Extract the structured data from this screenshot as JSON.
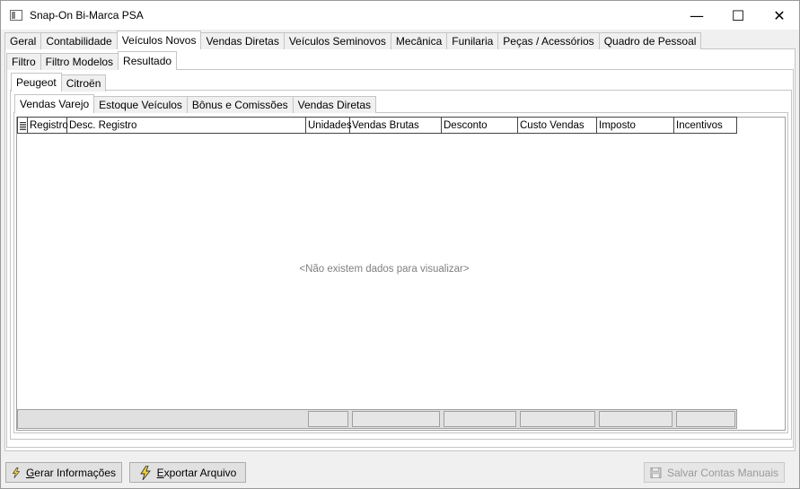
{
  "window": {
    "title": "Snap-On Bi-Marca PSA",
    "minimize_glyph": "—",
    "maximize_glyph": "☐",
    "close_glyph": "✕"
  },
  "main_tabs": [
    "Geral",
    "Contabilidade",
    "Veículos Novos",
    "Vendas Diretas",
    "Veículos Seminovos",
    "Mecânica",
    "Funilaria",
    "Peças / Acessórios",
    "Quadro de Pessoal"
  ],
  "sub_tabs": [
    "Filtro",
    "Filtro Modelos",
    "Resultado"
  ],
  "brand_tabs": [
    "Peugeot",
    "Citroën"
  ],
  "report_tabs": [
    "Vendas Varejo",
    "Estoque Veículos",
    "Bônus e Comissões",
    "Vendas Diretas"
  ],
  "grid": {
    "columns": [
      "Registro",
      "Desc. Registro",
      "Unidades",
      "Vendas Brutas",
      "Desconto",
      "Custo Vendas",
      "Imposto",
      "Incentivos"
    ],
    "empty_message": "<Não existem dados para visualizar>"
  },
  "buttons": {
    "gerar": {
      "first": "G",
      "rest": "erar Informações"
    },
    "exportar": {
      "first": "E",
      "rest": "xportar Arquivo"
    },
    "salvar": "Salvar Contas Manuais"
  },
  "colors": {
    "bolt": "#f2d23a",
    "disabled_text": "#9a9a9a"
  },
  "icons": {
    "action_button": "lightning-bolt-icon",
    "save_button": "floppy-disk-icon"
  }
}
